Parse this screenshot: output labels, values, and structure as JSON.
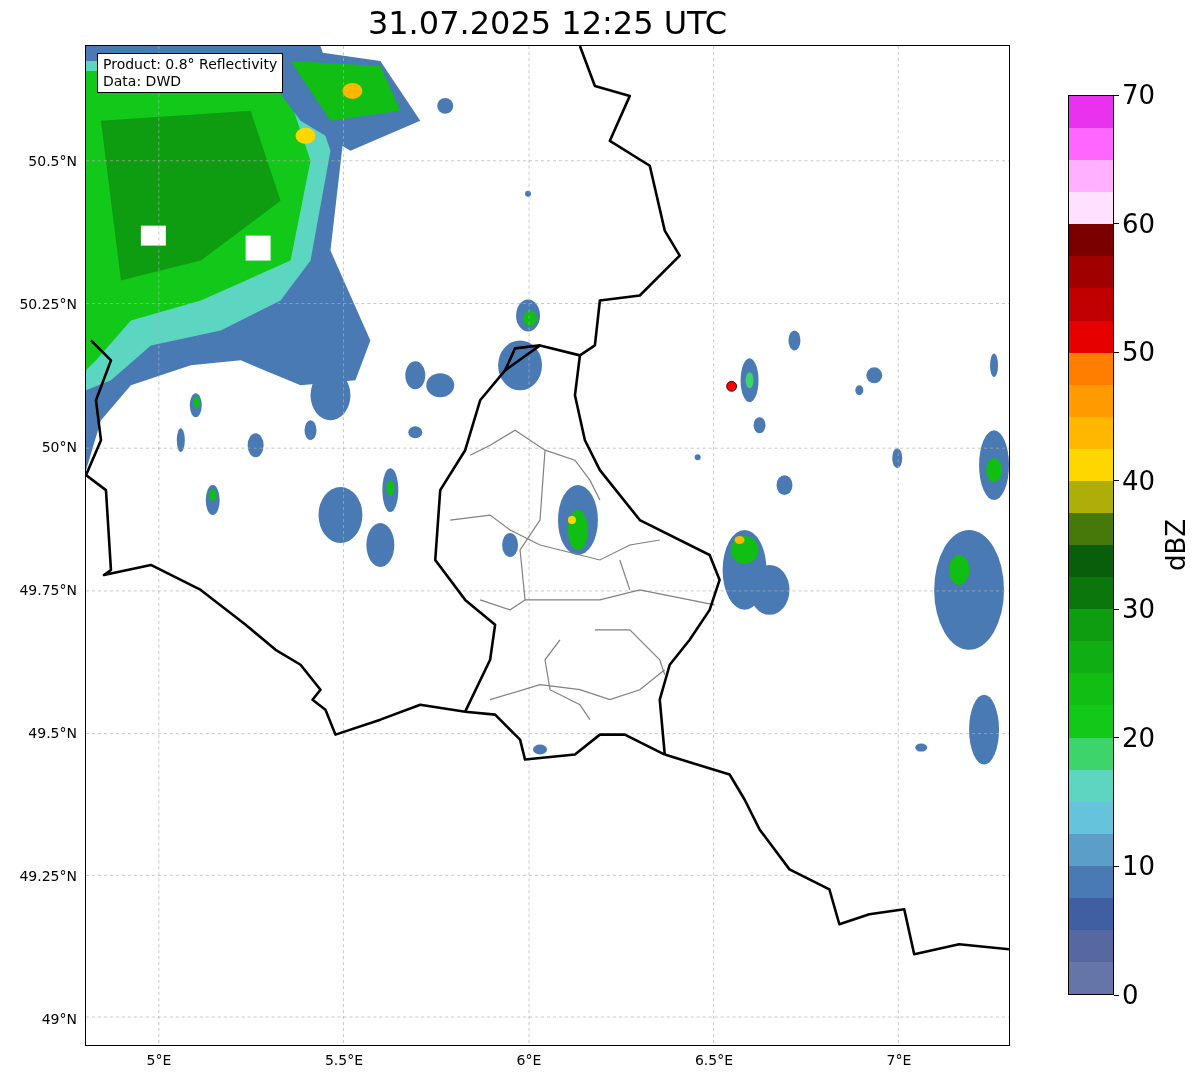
{
  "title": "31.07.2025 12:25 UTC",
  "annotation": {
    "lines": [
      "Product: 0.8° Reflectivity",
      "Data: DWD"
    ]
  },
  "map": {
    "lat_labels": [
      "50.5°N",
      "50.25°N",
      "50°N",
      "49.75°N",
      "49.5°N",
      "49.25°N",
      "49°N"
    ],
    "lon_labels": [
      "5°E",
      "5.5°E",
      "6°E",
      "6.5°E",
      "7°E"
    ]
  },
  "colorbar": {
    "label": "dBZ",
    "ticks": [
      "70",
      "60",
      "50",
      "40",
      "30",
      "20",
      "10",
      "0"
    ],
    "segments": [
      {
        "color": "#e832ee"
      },
      {
        "color": "#ff66ff"
      },
      {
        "color": "#ffb0ff"
      },
      {
        "color": "#ffe0ff"
      },
      {
        "color": "#7a0000"
      },
      {
        "color": "#a00000"
      },
      {
        "color": "#c00000"
      },
      {
        "color": "#e60000"
      },
      {
        "color": "#ff7e00"
      },
      {
        "color": "#ff9a00"
      },
      {
        "color": "#ffb700"
      },
      {
        "color": "#ffd700"
      },
      {
        "color": "#aeae0a"
      },
      {
        "color": "#47780a"
      },
      {
        "color": "#085e0a"
      },
      {
        "color": "#0b760c"
      },
      {
        "color": "#0e9c10"
      },
      {
        "color": "#0fae12"
      },
      {
        "color": "#10be14"
      },
      {
        "color": "#12c91a"
      },
      {
        "color": "#3dd46c"
      },
      {
        "color": "#5dd6c1"
      },
      {
        "color": "#66c3dc"
      },
      {
        "color": "#5b9ec8"
      },
      {
        "color": "#4a7ab3"
      },
      {
        "color": "#405fa3"
      },
      {
        "color": "#5668a0"
      },
      {
        "color": "#6575a8"
      }
    ]
  }
}
